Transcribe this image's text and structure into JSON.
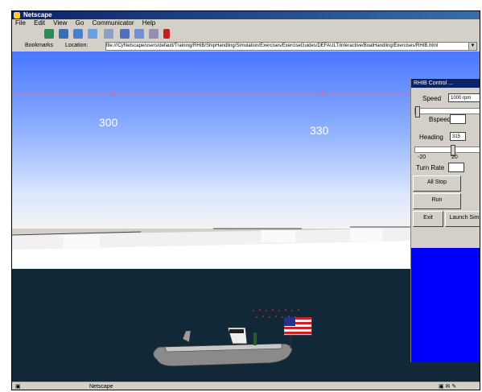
{
  "window": {
    "title": "Netscape"
  },
  "menu": [
    "File",
    "Edit",
    "View",
    "Go",
    "Communicator",
    "Help"
  ],
  "toolbar": {
    "icons": [
      "back-icon",
      "forward-icon",
      "reload-icon",
      "home-icon",
      "search-icon",
      "netscape-icon",
      "print-icon",
      "security-icon",
      "stop-icon"
    ]
  },
  "location": {
    "bookmarks_label": "Bookmarks",
    "location_label": "Location:",
    "url": "file:///C|/Netscape/users/default/Training/RHIB/ShipHandling/Simulation/Exercises/ExerciseGuides/DEFAULT/interactive/BoatHandling/Exercises/RHIB.html"
  },
  "scene": {
    "heading_left": "300",
    "heading_right": "330"
  },
  "panel": {
    "title": "RHIB Control ...",
    "speed_label": "Speed",
    "speed_value": "1000 rpm",
    "bspeed_label": "Bspeed",
    "bspeed_value": "",
    "heading_label": "Heading",
    "heading_value": "315",
    "slider_min": "-20",
    "slider_max": "20",
    "turn_rate_label": "Turn Rate",
    "turn_rate_value": "",
    "speed_slider_value": 0.0,
    "heading_slider_value": 0.55,
    "all_stop_button": "All Stop",
    "run_button": "Run",
    "exit_button": "Exit",
    "launch_button": "Launch Sim"
  },
  "status": {
    "text": "Netscape"
  },
  "colors": {
    "sea": "#112838",
    "panel_blue": "#0000ff",
    "titlebar": "#0a246a"
  }
}
